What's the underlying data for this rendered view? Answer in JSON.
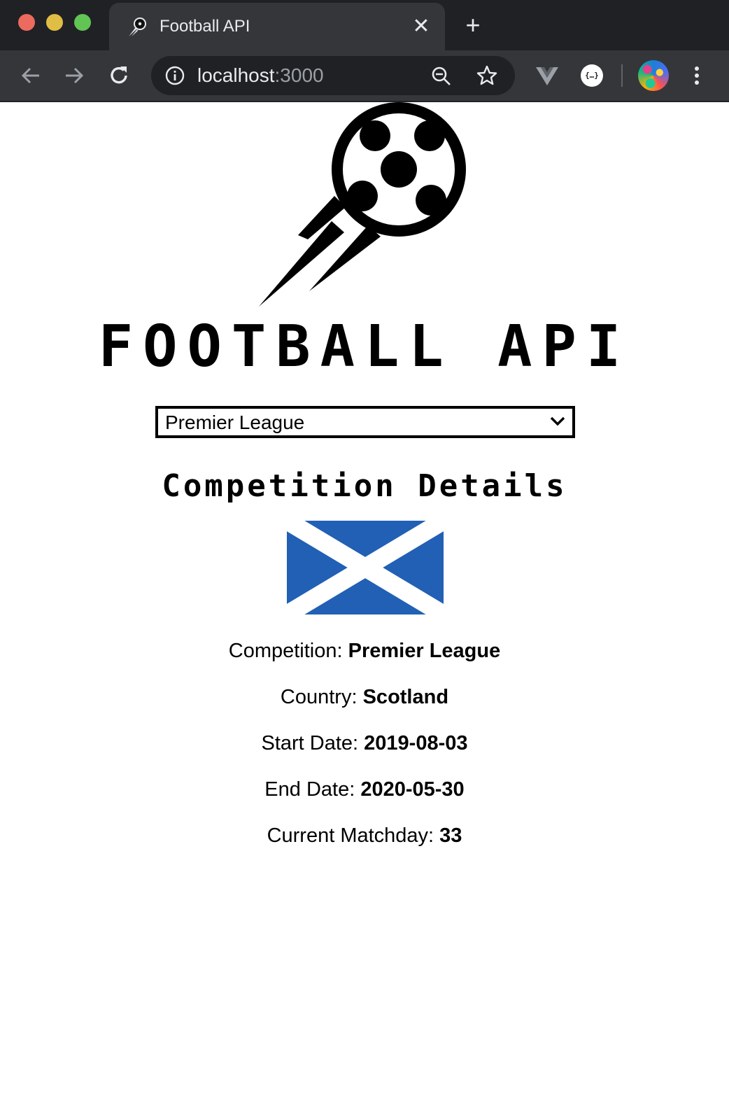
{
  "browser": {
    "tab_title": "Football API",
    "tab_close": "✕",
    "new_tab": "+",
    "url_host": "localhost",
    "url_port": ":3000",
    "extension_json_label": "{…}"
  },
  "page": {
    "brand": "FOOTBALL API",
    "competition_select": {
      "selected": "Premier League"
    },
    "section_title": "Competition Details",
    "flag": "scotland-flag",
    "details": [
      {
        "label": "Competition:",
        "value": "Premier League"
      },
      {
        "label": "Country:",
        "value": "Scotland"
      },
      {
        "label": "Start Date:",
        "value": "2019-08-03"
      },
      {
        "label": "End Date:",
        "value": "2020-05-30"
      },
      {
        "label": "Current Matchday:",
        "value": "33"
      }
    ]
  },
  "colors": {
    "chrome_dark": "#202124",
    "chrome_tab": "#35363a",
    "flag_blue": "#2160b5",
    "text": "#000000"
  }
}
